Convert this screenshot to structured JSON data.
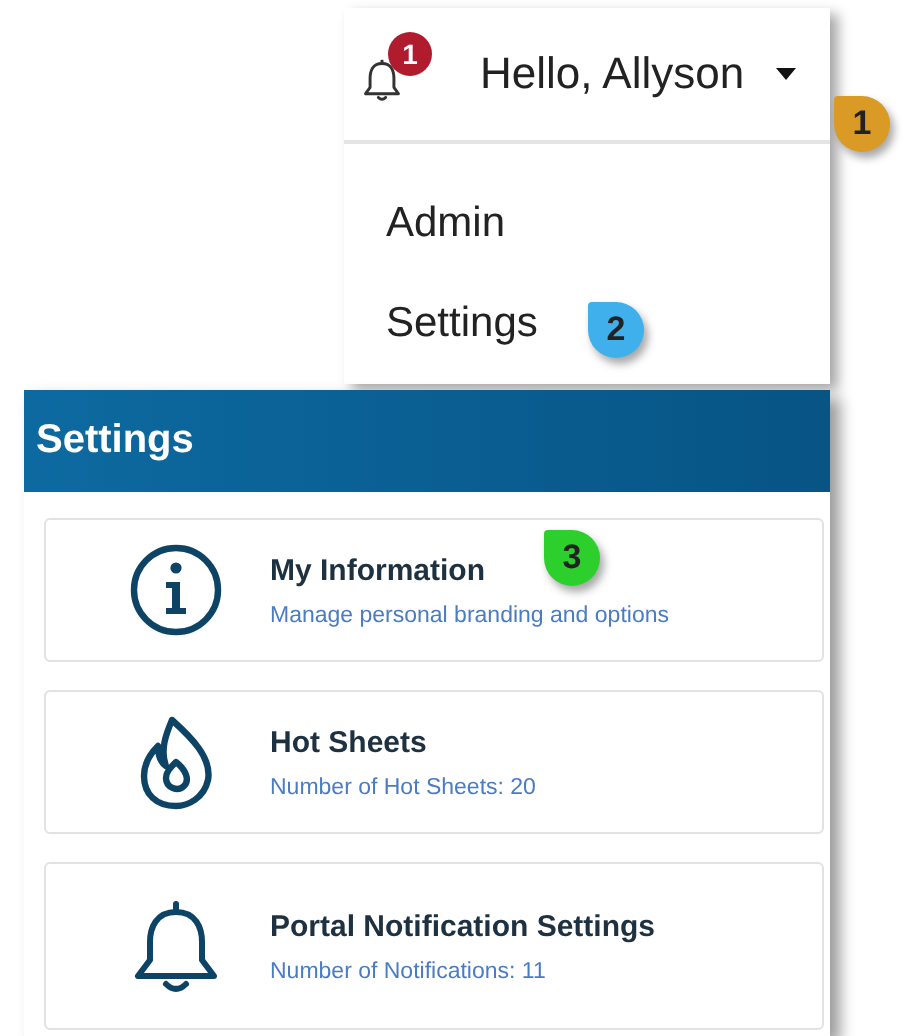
{
  "header": {
    "notification_count": "1",
    "greeting": "Hello, Allyson"
  },
  "menu": {
    "items": [
      {
        "label": "Admin"
      },
      {
        "label": "Settings"
      }
    ]
  },
  "settings": {
    "title": "Settings",
    "cards": [
      {
        "kind": "info",
        "title": "My Information",
        "subtitle": "Manage personal branding and options"
      },
      {
        "kind": "flame",
        "title": "Hot Sheets",
        "subtitle": "Number of Hot Sheets: 20"
      },
      {
        "kind": "bell",
        "title": "Portal Notification Settings",
        "subtitle": "Number of Notifications: 11"
      }
    ]
  },
  "callouts": [
    {
      "label": "1",
      "color": "#d99a26"
    },
    {
      "label": "2",
      "color": "#3fb0ec"
    },
    {
      "label": "3",
      "color": "#2ccf2c"
    }
  ]
}
